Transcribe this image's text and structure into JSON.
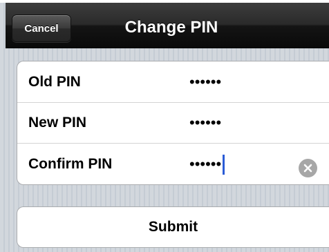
{
  "navbar": {
    "cancel_label": "Cancel",
    "title": "Change PIN"
  },
  "form": {
    "rows": [
      {
        "label": "Old PIN",
        "value": "••••••"
      },
      {
        "label": "New PIN",
        "value": "••••••"
      },
      {
        "label": "Confirm PIN",
        "value": "••••••"
      }
    ],
    "clear_icon": "clear-circle-x-icon"
  },
  "submit_label": "Submit",
  "colors": {
    "navbar": "#141414",
    "background": "#c5ccd4",
    "caret": "#2a5cd6",
    "clear_button": "#a7a7a7"
  }
}
